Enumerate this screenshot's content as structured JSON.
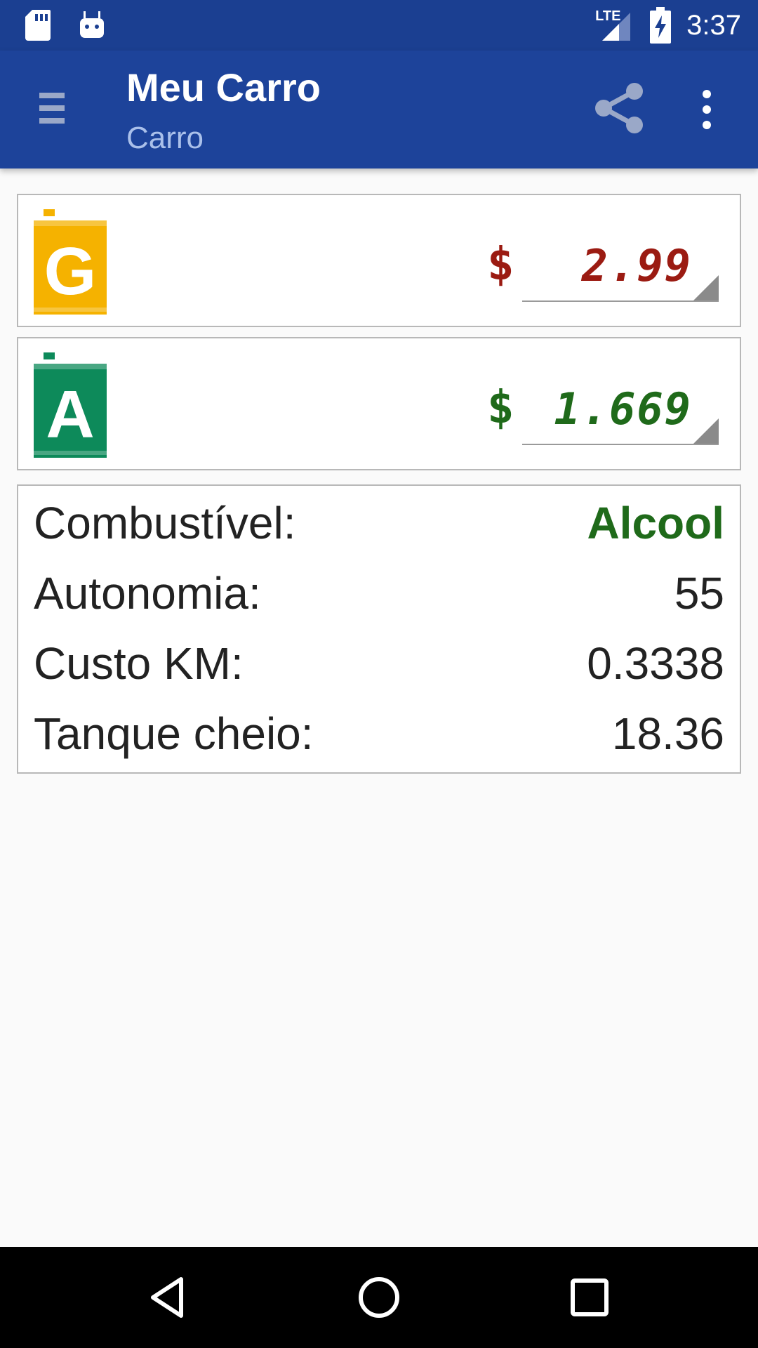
{
  "status_bar": {
    "network": "LTE",
    "time": "3:37",
    "icons": [
      "sd-card-icon",
      "android-icon",
      "lte-signal-icon",
      "battery-charging-icon"
    ]
  },
  "app_bar": {
    "title": "Meu Carro",
    "subtitle": "Carro",
    "icons": [
      "menu-icon",
      "share-icon",
      "more-vert-icon"
    ]
  },
  "fuels": [
    {
      "badge_letter": "G",
      "badge_color": "#f5b200",
      "currency": "$",
      "price": "2.99",
      "price_color": "#9b1b12"
    },
    {
      "badge_letter": "A",
      "badge_color": "#0d8a5a",
      "currency": "$",
      "price": "1.669",
      "price_color": "#1f6a1a"
    }
  ],
  "results": {
    "fuel_label": "Combustível:",
    "fuel_value": "Alcool",
    "fuel_value_color": "#1f6a1a",
    "autonomy_label": "Autonomia:",
    "autonomy_value": "55",
    "cost_km_label": "Custo KM:",
    "cost_km_value": "0.3338",
    "full_tank_label": "Tanque cheio:",
    "full_tank_value": "18.36"
  },
  "nav_bar": {
    "icons": [
      "back-icon",
      "home-icon",
      "recents-icon"
    ]
  }
}
